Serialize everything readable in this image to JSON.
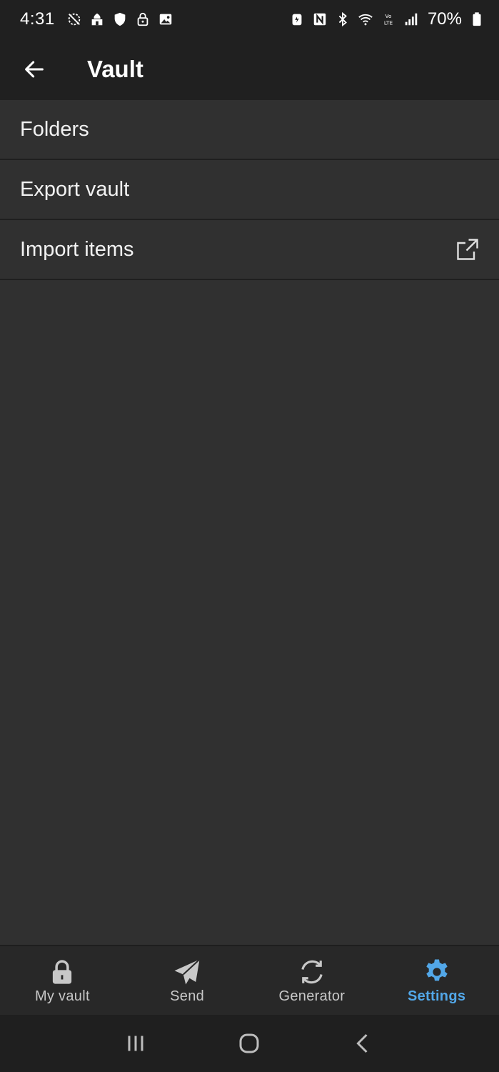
{
  "status_bar": {
    "time": "4:31",
    "battery": "70%",
    "left_icons": [
      "clock-off-icon",
      "mosque-icon",
      "shield-icon",
      "lock-icon",
      "image-icon"
    ],
    "right_icons": [
      "battery-saver-icon",
      "nfc-icon",
      "bluetooth-icon",
      "wifi-icon",
      "volte-icon",
      "signal-icon",
      "battery-icon"
    ]
  },
  "app_bar": {
    "title": "Vault"
  },
  "list": {
    "items": [
      {
        "label": "Folders"
      },
      {
        "label": "Export vault"
      },
      {
        "label": "Import items",
        "icon": "external-link-icon"
      }
    ]
  },
  "tabs": [
    {
      "label": "My vault",
      "icon": "lock-icon",
      "active": false
    },
    {
      "label": "Send",
      "icon": "paper-plane-icon",
      "active": false
    },
    {
      "label": "Generator",
      "icon": "refresh-icon",
      "active": false
    },
    {
      "label": "Settings",
      "icon": "gear-icon",
      "active": true
    }
  ],
  "colors": {
    "background": "#303030",
    "app_bar": "#202020",
    "accent": "#52a7e8",
    "tab_inactive": "#c8c8c8"
  }
}
